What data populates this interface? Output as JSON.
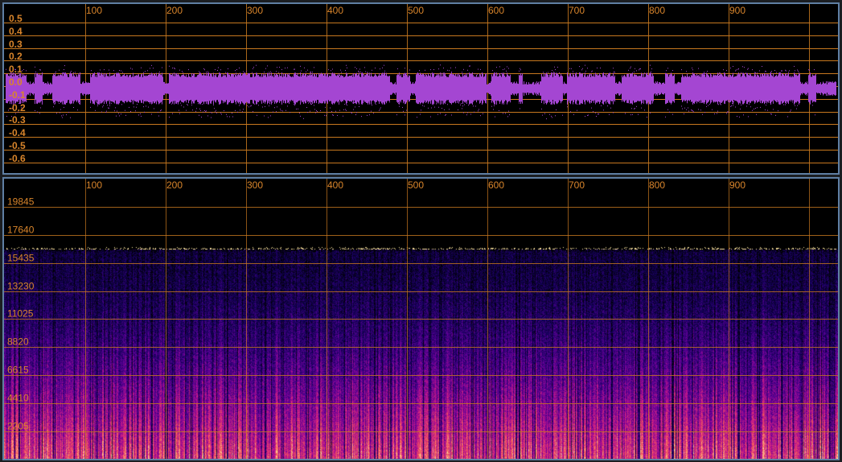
{
  "waveform": {
    "x_ticks": [
      "100",
      "200",
      "300",
      "400",
      "500",
      "600",
      "700",
      "800",
      "900"
    ],
    "y_ticks": [
      "0.5",
      "0.4",
      "0.3",
      "0.2",
      "0.1",
      "0.0",
      "-0.1",
      "-0.2",
      "-0.3",
      "-0.4",
      "-0.5",
      "-0.6"
    ],
    "wave_color": "#a446d2"
  },
  "spectrogram": {
    "x_ticks": [
      "100",
      "200",
      "300",
      "400",
      "500",
      "600",
      "700",
      "800",
      "900"
    ],
    "y_ticks": [
      "19845",
      "17640",
      "15435",
      "13230",
      "11025",
      "8820",
      "6615",
      "4410",
      "2205"
    ],
    "cutoff_hz": 16500,
    "max_hz": 22050
  },
  "colors": {
    "grid": "#c7781f",
    "label": "#d9852b",
    "panel_border": "#5f7fa3",
    "background": "#000000"
  }
}
